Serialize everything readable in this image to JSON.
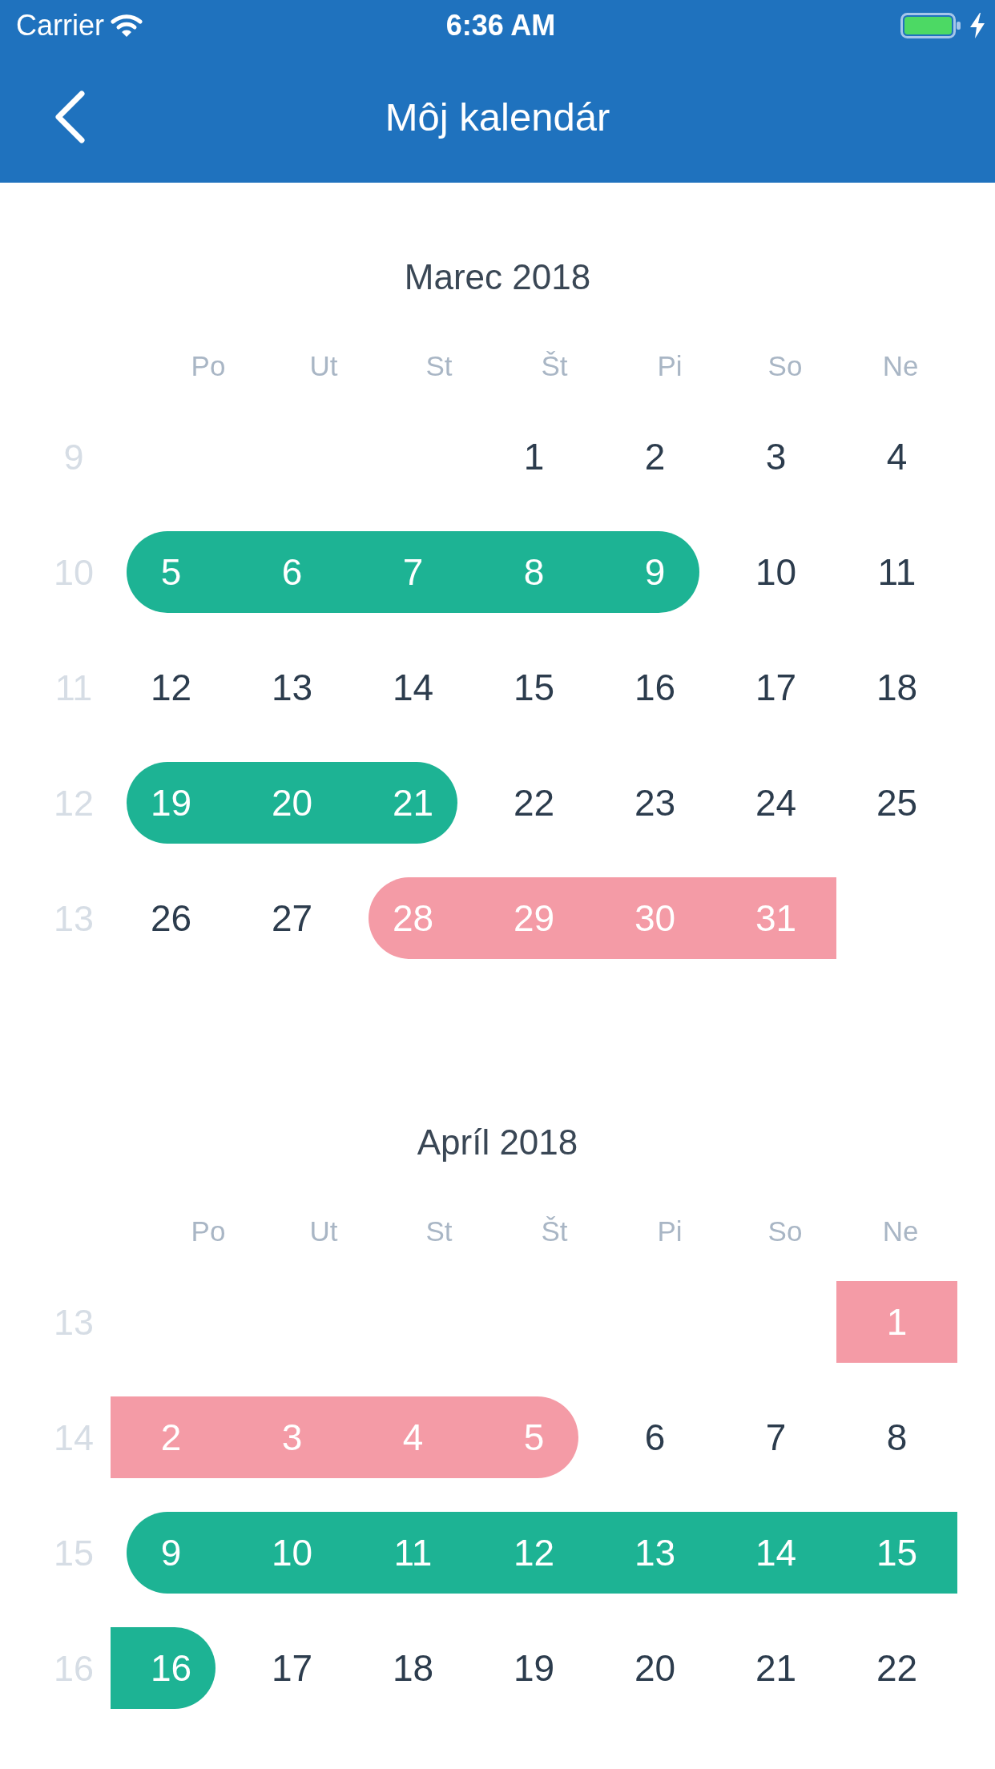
{
  "status_bar": {
    "carrier": "Carrier",
    "time": "6:36 AM"
  },
  "nav_bar": {
    "title": "Môj kalendár"
  },
  "months": [
    {
      "title": "Marec 2018",
      "weekdays": [
        "Po",
        "Ut",
        "St",
        "Št",
        "Pi",
        "So",
        "Ne"
      ],
      "weeks": [
        {
          "number": "9",
          "days": [
            {
              "kind": "blank"
            },
            {
              "kind": "blank"
            },
            {
              "kind": "blank"
            },
            {
              "kind": "day",
              "label": "1"
            },
            {
              "kind": "day",
              "label": "2"
            },
            {
              "kind": "day",
              "label": "3"
            },
            {
              "kind": "day",
              "label": "4"
            }
          ]
        },
        {
          "number": "10",
          "days": [
            {
              "kind": "day",
              "label": "5",
              "color": "#1db394",
              "range_start": true,
              "range_end": false
            },
            {
              "kind": "day",
              "label": "6",
              "color": "#1db394",
              "range_start": false,
              "range_end": false
            },
            {
              "kind": "day",
              "label": "7",
              "color": "#1db394",
              "range_start": false,
              "range_end": false
            },
            {
              "kind": "day",
              "label": "8",
              "color": "#1db394",
              "range_start": false,
              "range_end": false
            },
            {
              "kind": "day",
              "label": "9",
              "color": "#1db394",
              "range_start": false,
              "range_end": true
            },
            {
              "kind": "day",
              "label": "10"
            },
            {
              "kind": "day",
              "label": "11"
            }
          ]
        },
        {
          "number": "11",
          "days": [
            {
              "kind": "day",
              "label": "12"
            },
            {
              "kind": "day",
              "label": "13"
            },
            {
              "kind": "day",
              "label": "14"
            },
            {
              "kind": "day",
              "label": "15"
            },
            {
              "kind": "day",
              "label": "16"
            },
            {
              "kind": "day",
              "label": "17"
            },
            {
              "kind": "day",
              "label": "18"
            }
          ]
        },
        {
          "number": "12",
          "days": [
            {
              "kind": "day",
              "label": "19",
              "color": "#1db394",
              "range_start": true,
              "range_end": false
            },
            {
              "kind": "day",
              "label": "20",
              "color": "#1db394",
              "range_start": false,
              "range_end": false
            },
            {
              "kind": "day",
              "label": "21",
              "color": "#1db394",
              "range_start": false,
              "range_end": true
            },
            {
              "kind": "day",
              "label": "22"
            },
            {
              "kind": "day",
              "label": "23"
            },
            {
              "kind": "day",
              "label": "24"
            },
            {
              "kind": "day",
              "label": "25"
            }
          ]
        },
        {
          "number": "13",
          "days": [
            {
              "kind": "day",
              "label": "26"
            },
            {
              "kind": "day",
              "label": "27"
            },
            {
              "kind": "day",
              "label": "28",
              "color": "#f49ba6",
              "range_start": true,
              "range_end": false
            },
            {
              "kind": "day",
              "label": "29",
              "color": "#f49ba6",
              "range_start": false,
              "range_end": false
            },
            {
              "kind": "day",
              "label": "30",
              "color": "#f49ba6",
              "range_start": false,
              "range_end": false
            },
            {
              "kind": "day",
              "label": "31",
              "color": "#f49ba6",
              "range_start": false,
              "range_end": false
            },
            {
              "kind": "blank"
            }
          ]
        }
      ]
    },
    {
      "title": "Apríl 2018",
      "weekdays": [
        "Po",
        "Ut",
        "St",
        "Št",
        "Pi",
        "So",
        "Ne"
      ],
      "weeks": [
        {
          "number": "13",
          "days": [
            {
              "kind": "blank"
            },
            {
              "kind": "blank"
            },
            {
              "kind": "blank"
            },
            {
              "kind": "blank"
            },
            {
              "kind": "blank"
            },
            {
              "kind": "blank"
            },
            {
              "kind": "day",
              "label": "1",
              "color": "#f49ba6",
              "range_start": false,
              "range_end": false
            }
          ]
        },
        {
          "number": "14",
          "days": [
            {
              "kind": "day",
              "label": "2",
              "color": "#f49ba6",
              "range_start": false,
              "range_end": false
            },
            {
              "kind": "day",
              "label": "3",
              "color": "#f49ba6",
              "range_start": false,
              "range_end": false
            },
            {
              "kind": "day",
              "label": "4",
              "color": "#f49ba6",
              "range_start": false,
              "range_end": false
            },
            {
              "kind": "day",
              "label": "5",
              "color": "#f49ba6",
              "range_start": false,
              "range_end": true
            },
            {
              "kind": "day",
              "label": "6"
            },
            {
              "kind": "day",
              "label": "7"
            },
            {
              "kind": "day",
              "label": "8"
            }
          ]
        },
        {
          "number": "15",
          "days": [
            {
              "kind": "day",
              "label": "9",
              "color": "#1db394",
              "range_start": true,
              "range_end": false
            },
            {
              "kind": "day",
              "label": "10",
              "color": "#1db394",
              "range_start": false,
              "range_end": false
            },
            {
              "kind": "day",
              "label": "11",
              "color": "#1db394",
              "range_start": false,
              "range_end": false
            },
            {
              "kind": "day",
              "label": "12",
              "color": "#1db394",
              "range_start": false,
              "range_end": false
            },
            {
              "kind": "day",
              "label": "13",
              "color": "#1db394",
              "range_start": false,
              "range_end": false
            },
            {
              "kind": "day",
              "label": "14",
              "color": "#1db394",
              "range_start": false,
              "range_end": false
            },
            {
              "kind": "day",
              "label": "15",
              "color": "#1db394",
              "range_start": false,
              "range_end": false
            }
          ]
        },
        {
          "number": "16",
          "days": [
            {
              "kind": "day",
              "label": "16",
              "color": "#1db394",
              "range_start": false,
              "range_end": true
            },
            {
              "kind": "day",
              "label": "17"
            },
            {
              "kind": "day",
              "label": "18"
            },
            {
              "kind": "day",
              "label": "19"
            },
            {
              "kind": "day",
              "label": "20"
            },
            {
              "kind": "day",
              "label": "21"
            },
            {
              "kind": "day",
              "label": "22"
            }
          ]
        }
      ]
    }
  ]
}
